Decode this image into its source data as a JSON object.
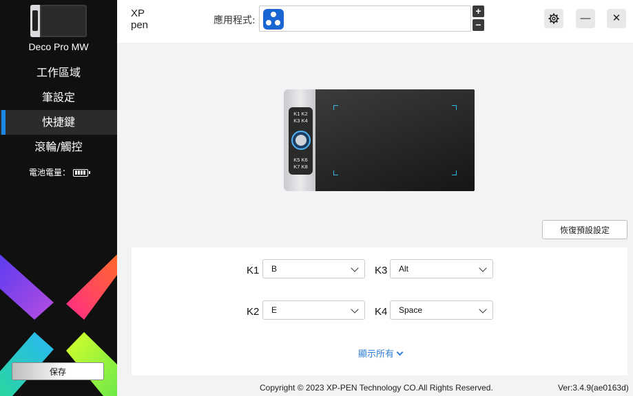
{
  "sidebar": {
    "device_name": "Deco Pro MW",
    "items": [
      {
        "label": "工作區域"
      },
      {
        "label": "筆設定"
      },
      {
        "label": "快捷鍵",
        "active": true
      },
      {
        "label": "滾輪/觸控"
      }
    ],
    "battery_label": "電池電量：",
    "save_label": "保存"
  },
  "header": {
    "logo_top": "XP",
    "logo_bottom": "pen",
    "app_label": "應用程式:",
    "add_icon": "plus-icon",
    "remove_icon": "minus-icon",
    "settings_icon": "gear-icon",
    "minimize_icon": "minimize-icon",
    "close_icon": "close-icon"
  },
  "device_keys": {
    "top_row1": "K1 K2",
    "top_row2": "K3 K4",
    "bottom_row1": "K5 K6",
    "bottom_row2": "K7 K8"
  },
  "restore_label": "恢復預設設定",
  "keys": [
    {
      "label": "K1",
      "value": "B"
    },
    {
      "label": "K3",
      "value": "Alt"
    },
    {
      "label": "K2",
      "value": "E"
    },
    {
      "label": "K4",
      "value": "Space"
    }
  ],
  "show_all_label": "顯示所有",
  "footer": {
    "copyright": "Copyright © 2023  XP-PEN Technology CO.All Rights Reserved.",
    "version": "Ver:3.4.9(ae0163d)"
  },
  "colors": {
    "accent": "#1e88e5",
    "link": "#2f7fd6",
    "corner_marks": "#35b7e8"
  }
}
